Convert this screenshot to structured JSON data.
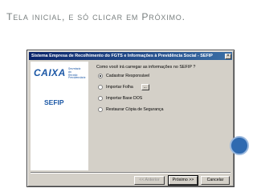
{
  "slide": {
    "title": "Tela inicial, e só clicar em Próximo."
  },
  "window": {
    "title": "Sistema Empresa de Recolhimento do FGTS e Informações à Previdência Social - SEFIP",
    "close_glyph": "×"
  },
  "logo": {
    "caixa": "CAIXA",
    "caixa_sub": [
      "Secretaria",
      "da",
      "Receita",
      "Previdenciária"
    ],
    "sefip": "SEFIP"
  },
  "dialog": {
    "question": "Como você irá carregar as informações no SEFIP ?",
    "options": [
      {
        "label": "Cadastrar Responsável",
        "checked": true
      },
      {
        "label": "Importar Folha",
        "checked": false,
        "extra_button": "..."
      },
      {
        "label": "Importar Base DOS",
        "checked": false
      },
      {
        "label": "Restaurar Cópia de Segurança",
        "checked": false
      }
    ]
  },
  "buttons": {
    "back": "<< Anterior",
    "next": "Próximo >>",
    "cancel": "Cancelar"
  }
}
